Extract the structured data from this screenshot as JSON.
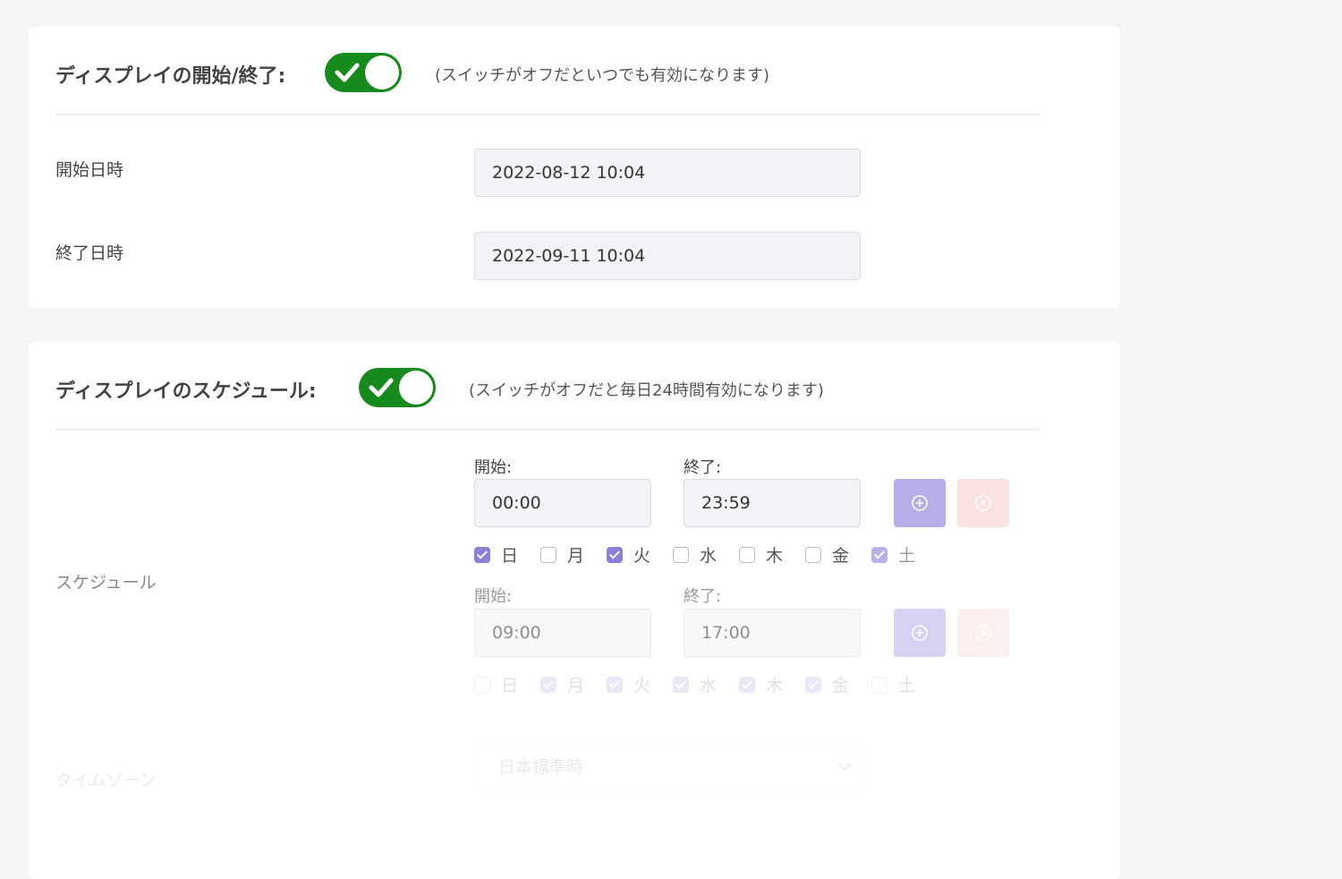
{
  "display_period": {
    "title": "ディスプレイの開始/終了:",
    "toggle_on": true,
    "hint": "(スイッチがオフだといつでも有効になります)",
    "start_label": "開始日時",
    "start_value": "2022-08-12 10:04",
    "end_label": "終了日時",
    "end_value": "2022-09-11 10:04"
  },
  "schedule": {
    "title": "ディスプレイのスケジュール:",
    "toggle_on": true,
    "hint": "(スイッチがオフだと毎日24時間有効になります)",
    "row_label": "スケジュール",
    "start_label": "開始:",
    "end_label": "終了:",
    "entries": [
      {
        "start": "00:00",
        "end": "23:59",
        "days": [
          {
            "label": "日",
            "checked": true
          },
          {
            "label": "月",
            "checked": false
          },
          {
            "label": "火",
            "checked": true
          },
          {
            "label": "水",
            "checked": false
          },
          {
            "label": "木",
            "checked": false
          },
          {
            "label": "金",
            "checked": false
          },
          {
            "label": "土",
            "checked": true
          }
        ]
      },
      {
        "start": "09:00",
        "end": "17:00",
        "days": [
          {
            "label": "日",
            "checked": false
          },
          {
            "label": "月",
            "checked": true
          },
          {
            "label": "火",
            "checked": true
          },
          {
            "label": "水",
            "checked": true
          },
          {
            "label": "木",
            "checked": true
          },
          {
            "label": "金",
            "checked": true
          },
          {
            "label": "土",
            "checked": false
          }
        ]
      }
    ],
    "timezone_label": "タイムゾーン",
    "timezone_value": "日本標準時"
  },
  "colors": {
    "toggle_on": "#168a1c",
    "add_button": "#b6aee6",
    "remove_button": "#fbe2e2",
    "checkbox_checked": "#8d7fd6"
  }
}
